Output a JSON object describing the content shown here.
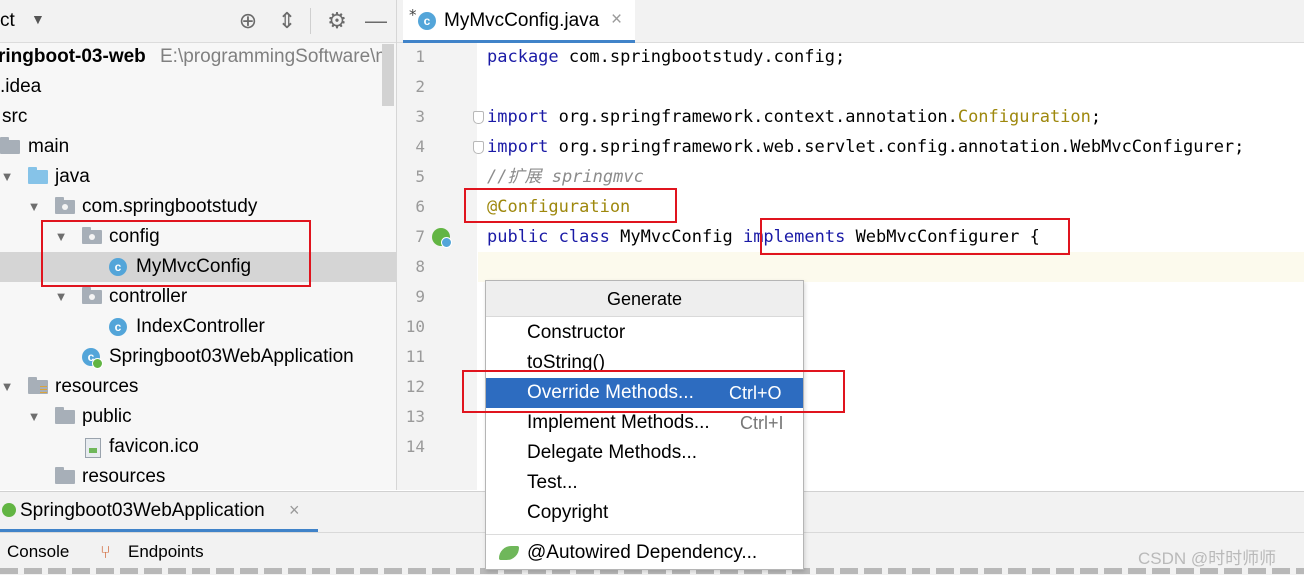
{
  "project_panel": {
    "title_fragment": "ct",
    "tree": [
      {
        "label": "ringboot-03-web",
        "path": "E:\\programmingSoftware\\m"
      },
      {
        "label": ".idea"
      },
      {
        "label": "src"
      },
      {
        "label": "main"
      },
      {
        "label": "java"
      },
      {
        "label": "com.springbootstudy"
      },
      {
        "label": "config"
      },
      {
        "label": "MyMvcConfig"
      },
      {
        "label": "controller"
      },
      {
        "label": "IndexController"
      },
      {
        "label": "Springboot03WebApplication"
      },
      {
        "label": "resources"
      },
      {
        "label": "public"
      },
      {
        "label": "favicon.ico"
      },
      {
        "label": "resources"
      }
    ]
  },
  "editor": {
    "tab": {
      "modified_mark": "*",
      "icon_letter": "c",
      "title": "MyMvcConfig.java",
      "close": "×"
    },
    "line_numbers": [
      "1",
      "2",
      "3",
      "4",
      "5",
      "6",
      "7",
      "8",
      "9",
      "10",
      "11",
      "12",
      "13",
      "14"
    ],
    "code": {
      "l1_kw": "package",
      "l1_rest": " com.springbootstudy.config;",
      "l3_kw": "import",
      "l3_pre": " org.springframework.context.annotation.",
      "l3_ann": "Configuration",
      "l3_end": ";",
      "l4_kw": "import",
      "l4_rest": " org.springframework.web.servlet.config.annotation.WebMvcConfigurer;",
      "l5_comment": "//扩展 springmvc",
      "l6_ann": "@Configuration",
      "l7_kw1": "public",
      "l7_kw2": "class",
      "l7_name": "MyMvcConfig",
      "l7_kw3": "implements",
      "l7_type": "WebMvcConfigurer",
      "l7_brace": "{"
    }
  },
  "generate_popup": {
    "title": "Generate",
    "items": [
      {
        "label": "Constructor",
        "shortcut": ""
      },
      {
        "label": "toString()",
        "shortcut": ""
      },
      {
        "label": "Override Methods...",
        "shortcut": "Ctrl+O"
      },
      {
        "label": "Implement Methods...",
        "shortcut": "Ctrl+I"
      },
      {
        "label": "Delegate Methods...",
        "shortcut": ""
      },
      {
        "label": "Test...",
        "shortcut": ""
      },
      {
        "label": "Copyright",
        "shortcut": ""
      },
      {
        "label": "@Autowired Dependency...",
        "shortcut": ""
      }
    ],
    "selected_index": 2
  },
  "run_panel": {
    "tab_label": "Springboot03WebApplication",
    "close": "×",
    "tools": [
      "Console",
      "Endpoints"
    ]
  },
  "watermark": "CSDN @时时师师",
  "colors": {
    "keyword": "#1a1aa6",
    "annotation": "#9e880d",
    "comment": "#8c8c8c",
    "selection": "#2d6cc0",
    "highlight_box": "#e0141e",
    "tab_underline": "#4083c9"
  }
}
